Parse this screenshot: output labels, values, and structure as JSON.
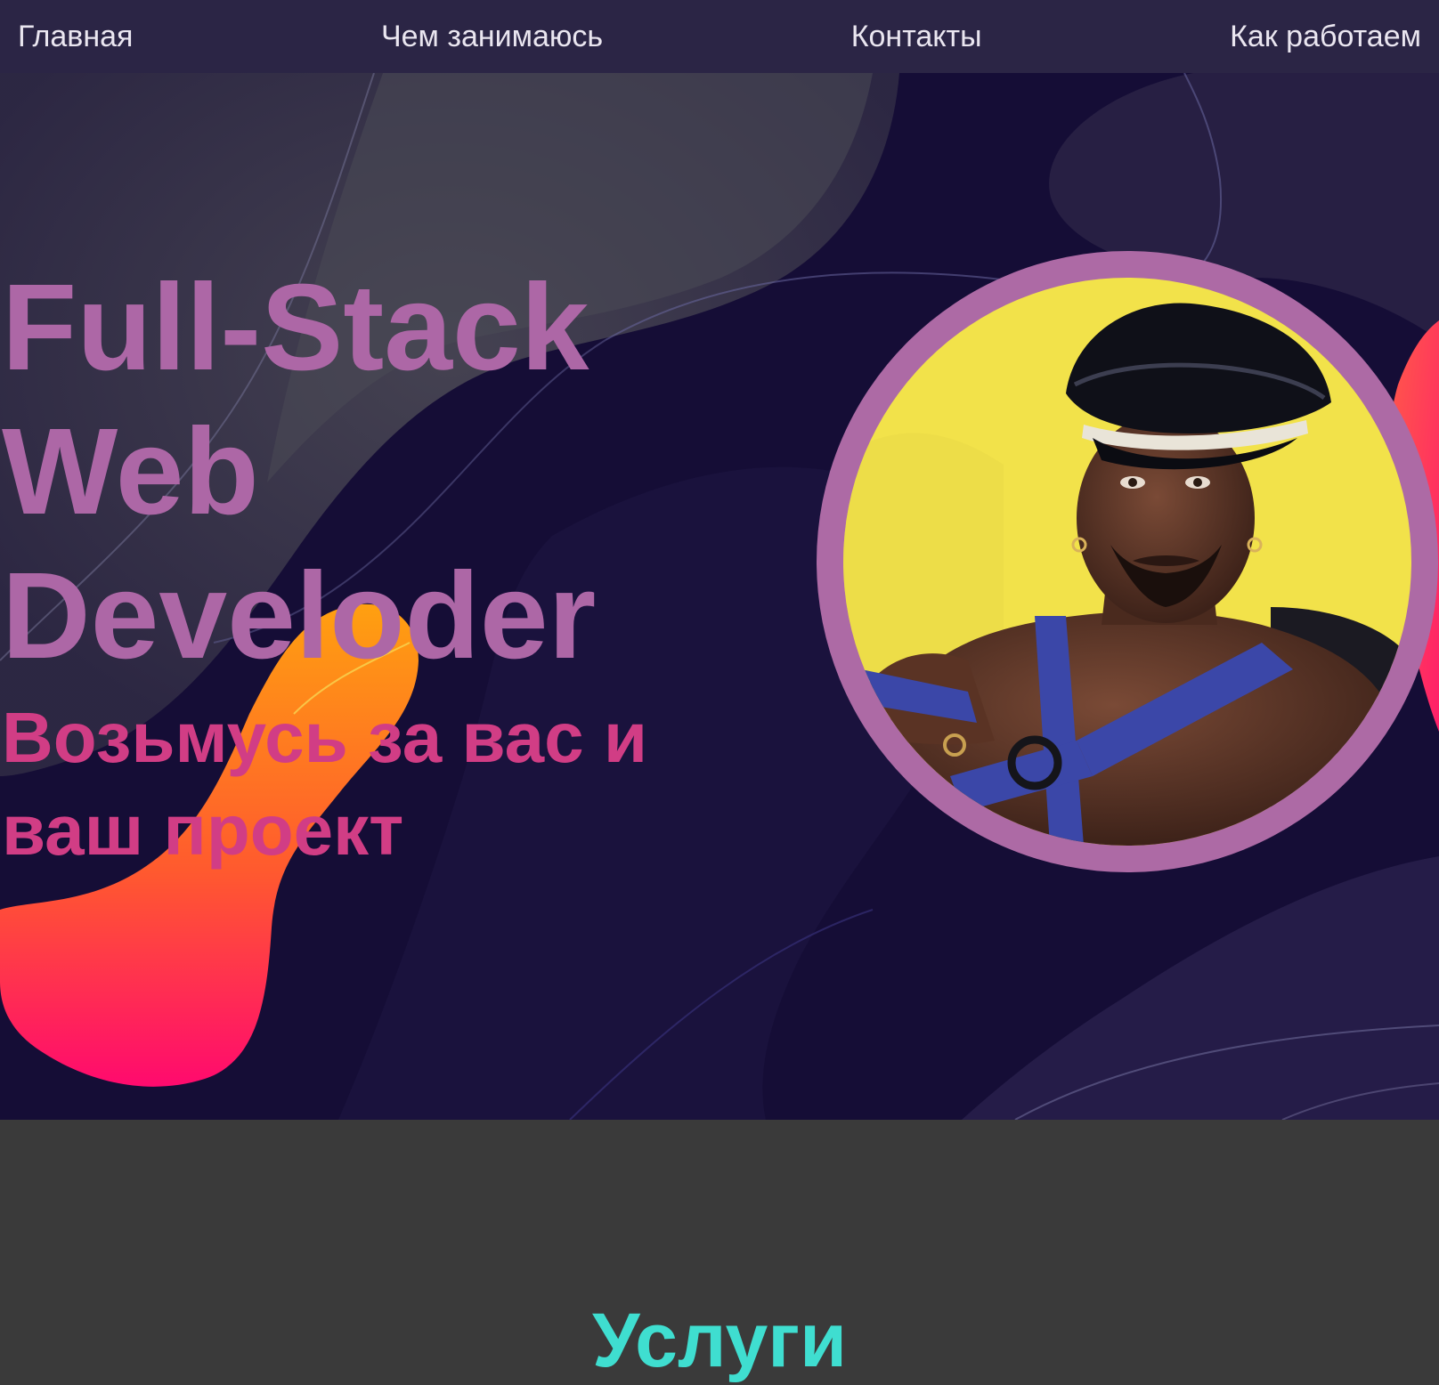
{
  "nav": {
    "items": [
      {
        "label": "Главная"
      },
      {
        "label": "Чем занимаюсь"
      },
      {
        "label": "Контакты"
      },
      {
        "label": "Как работаем"
      }
    ]
  },
  "hero": {
    "headline": "Full-Stack Web Develoder",
    "subline": "Возьмусь за вас и ваш проект",
    "portrait_icon": "person-portrait",
    "colors": {
      "nav_bg": "#2b2545",
      "hero_bg": "#140c33",
      "headline": "#ad67a6",
      "subline": "#d13d85",
      "portrait_ring": "#ad6aa5",
      "portrait_bg": "#f2e24a"
    }
  },
  "services": {
    "title": "Услуги",
    "title_color": "#3fded0"
  }
}
